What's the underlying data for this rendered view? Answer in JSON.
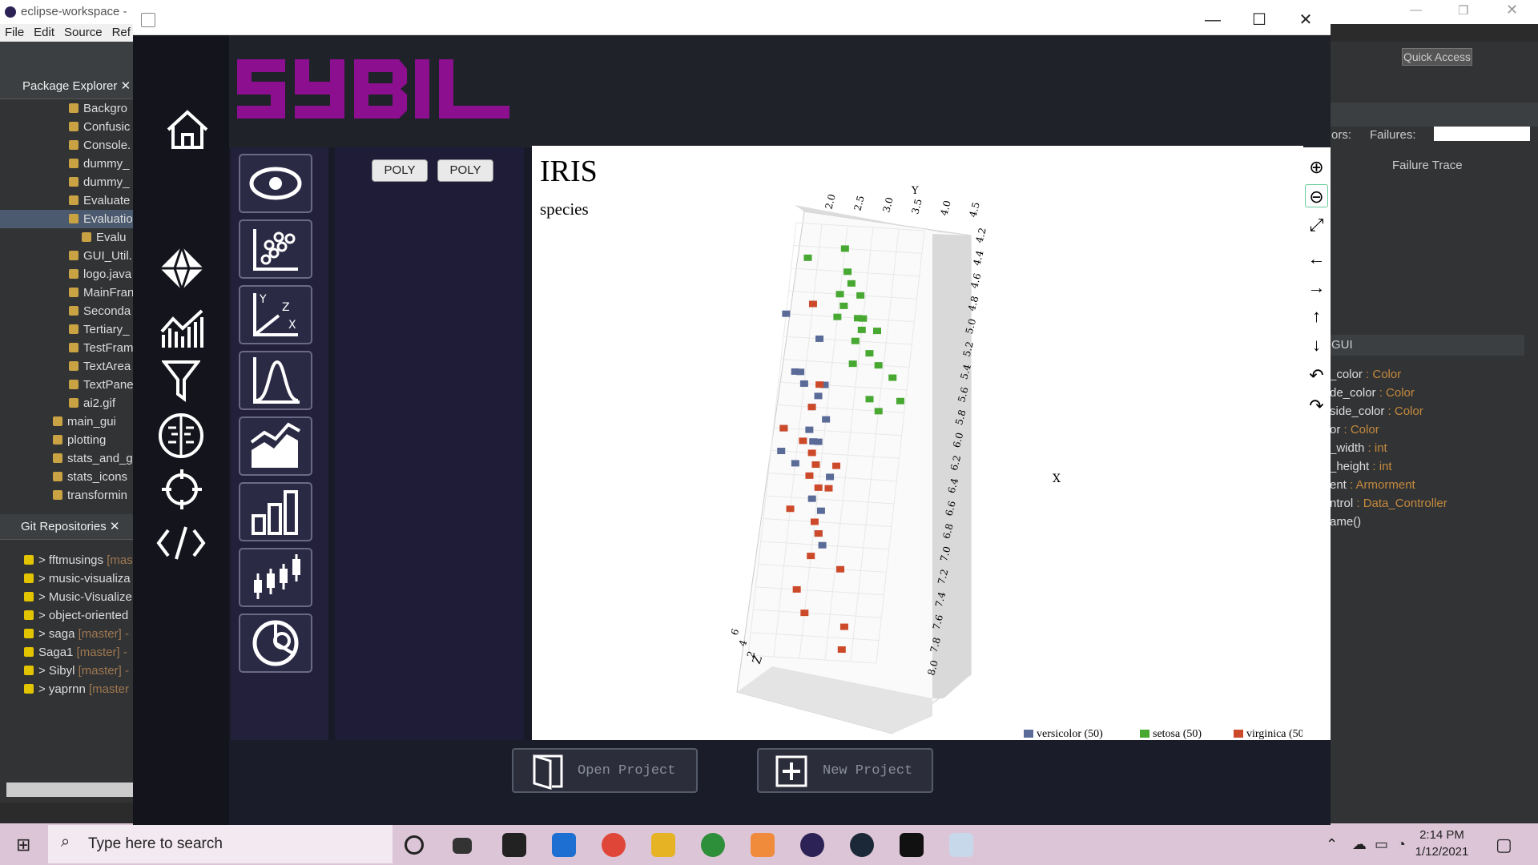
{
  "eclipse": {
    "title": "eclipse-workspace -",
    "menu": [
      "File",
      "Edit",
      "Source",
      "Ref"
    ],
    "package_explorer": {
      "label": "Package Explorer",
      "items": [
        "Backgro",
        "Confusic",
        "Console.",
        "dummy_",
        "dummy_",
        "Evaluate",
        "Evaluatio",
        "Evalu",
        "GUI_Util.",
        "logo.java",
        "MainFran",
        "Seconda",
        "Tertiary_",
        "TestFram",
        "TextArea",
        "TextPane",
        "ai2.gif",
        "main_gui",
        "plotting",
        "stats_and_g",
        "stats_icons",
        "transformin"
      ]
    },
    "git_repositories": {
      "label": "Git Repositories",
      "items": [
        {
          "name": "> fftmusings",
          "branch": "[mas"
        },
        {
          "name": "> music-visualiza",
          "branch": ""
        },
        {
          "name": "> Music-Visualize",
          "branch": ""
        },
        {
          "name": "> object-oriented",
          "branch": ""
        },
        {
          "name": "> saga",
          "branch": "[master] -"
        },
        {
          "name": "Saga1",
          "branch": "[master] -"
        },
        {
          "name": "> Sibyl",
          "branch": "[master] -"
        },
        {
          "name": "> yaprnn",
          "branch": "[master"
        }
      ]
    },
    "right_panel": {
      "quick_access": "Quick Access",
      "errors_label": "ors:",
      "failures_label": "Failures:",
      "failure_trace": "Failure Trace",
      "outline_title": "GUI",
      "outline_items": [
        {
          "name": "_color",
          "type": ": Color"
        },
        {
          "name": "de_color",
          "type": ": Color"
        },
        {
          "name": "side_color",
          "type": ": Color"
        },
        {
          "name": "or",
          "type": ": Color"
        },
        {
          "name": "_width",
          "type": ": int"
        },
        {
          "name": "_height",
          "type": ": int"
        },
        {
          "name": "ent",
          "type": ": Armorment"
        },
        {
          "name": "ntrol",
          "type": ": Data_Controller"
        },
        {
          "name": "ame()",
          "type": ""
        }
      ]
    }
  },
  "taskbar": {
    "search_placeholder": "Type here to search",
    "time": "2:14 PM",
    "date": "1/12/2021"
  },
  "app": {
    "logo_text": "SYBIL",
    "poly_buttons": [
      "POLY",
      "POLY"
    ],
    "open_project": "Open Project",
    "new_project": "New Project",
    "accent": "#8b0f8f"
  },
  "chart_data": {
    "type": "scatter",
    "title": "IRIS",
    "subtitle": "species",
    "axes": {
      "x": "X",
      "y": "Y",
      "z": "Z"
    },
    "y_ticks": [
      "2.0",
      "2.5",
      "3.0",
      "3.5",
      "4.0",
      "4.5"
    ],
    "x_ticks": [
      "4.2",
      "4.4",
      "4.6",
      "4.8",
      "5.0",
      "5.2",
      "5.4",
      "5.6",
      "5.8",
      "6.0",
      "6.2",
      "6.4",
      "6.6",
      "6.8",
      "7.0",
      "7.2",
      "7.4",
      "7.6",
      "7.8",
      "8.0"
    ],
    "z_ticks": [
      "6",
      "4",
      "2"
    ],
    "legend": [
      {
        "name": "versicolor (50)",
        "color": "#5a6b98"
      },
      {
        "name": "setosa (50)",
        "color": "#47a832"
      },
      {
        "name": "virginica (50)",
        "color": "#cc4a2a"
      }
    ],
    "series": [
      {
        "name": "setosa",
        "color": "#47a832",
        "points": [
          [
            4.4,
            3.0
          ],
          [
            4.5,
            2.3
          ],
          [
            4.6,
            3.1
          ],
          [
            4.7,
            3.2
          ],
          [
            4.8,
            3.4
          ],
          [
            4.9,
            3.1
          ],
          [
            5.0,
            3.4
          ],
          [
            5.0,
            3.5
          ],
          [
            5.1,
            3.5
          ],
          [
            5.1,
            3.8
          ],
          [
            5.2,
            3.4
          ],
          [
            5.3,
            3.7
          ],
          [
            5.4,
            3.9
          ],
          [
            5.4,
            3.4
          ],
          [
            5.5,
            4.2
          ],
          [
            5.7,
            4.4
          ],
          [
            5.8,
            4.0
          ],
          [
            5.7,
            3.8
          ],
          [
            4.8,
            3.0
          ],
          [
            5.0,
            3.0
          ]
        ]
      },
      {
        "name": "versicolor",
        "color": "#5a6b98",
        "points": [
          [
            5.0,
            2.0
          ],
          [
            5.2,
            2.7
          ],
          [
            5.5,
            2.3
          ],
          [
            5.6,
            2.9
          ],
          [
            5.7,
            2.8
          ],
          [
            5.8,
            2.7
          ],
          [
            5.9,
            3.0
          ],
          [
            6.0,
            2.2
          ],
          [
            6.1,
            2.9
          ],
          [
            6.2,
            2.2
          ],
          [
            6.3,
            2.5
          ],
          [
            6.4,
            3.2
          ],
          [
            6.6,
            2.9
          ],
          [
            6.7,
            3.1
          ],
          [
            6.9,
            3.1
          ],
          [
            7.0,
            3.2
          ],
          [
            5.5,
            2.4
          ],
          [
            5.6,
            2.5
          ],
          [
            6.0,
            2.7
          ],
          [
            6.1,
            2.8
          ]
        ]
      },
      {
        "name": "virginica",
        "color": "#cc4a2a",
        "points": [
          [
            4.9,
            2.5
          ],
          [
            5.6,
            2.8
          ],
          [
            5.8,
            2.7
          ],
          [
            6.0,
            2.2
          ],
          [
            6.1,
            2.6
          ],
          [
            6.2,
            2.8
          ],
          [
            6.3,
            2.9
          ],
          [
            6.4,
            2.8
          ],
          [
            6.5,
            3.0
          ],
          [
            6.7,
            2.5
          ],
          [
            6.9,
            3.1
          ],
          [
            7.1,
            3.0
          ],
          [
            7.2,
            3.6
          ],
          [
            7.4,
            2.8
          ],
          [
            7.6,
            3.0
          ],
          [
            7.7,
            3.8
          ],
          [
            7.9,
            3.8
          ],
          [
            6.3,
            3.3
          ],
          [
            6.5,
            3.2
          ],
          [
            6.8,
            3.0
          ]
        ]
      }
    ]
  }
}
